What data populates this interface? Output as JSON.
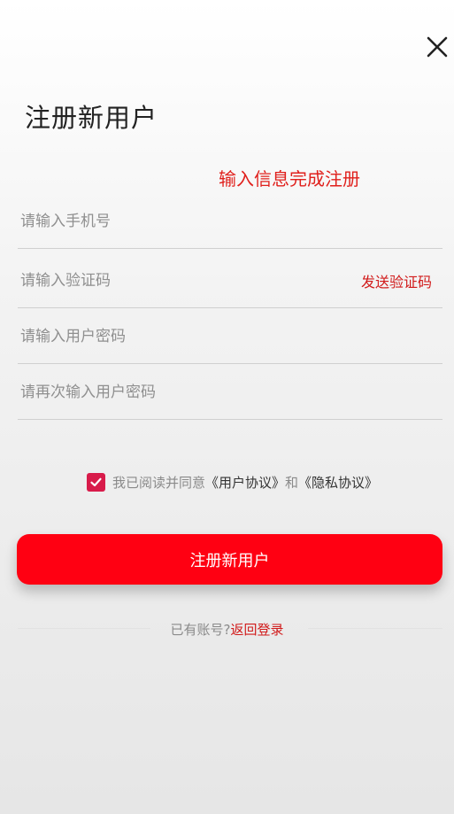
{
  "header": {
    "close_icon": "close-icon",
    "title": "注册新用户",
    "subtitle": "输入信息完成注册"
  },
  "form": {
    "phone_placeholder": "请输入手机号",
    "code_placeholder": "请输入验证码",
    "send_code_label": "发送验证码",
    "password_placeholder": "请输入用户密码",
    "password_confirm_placeholder": "请再次输入用户密码"
  },
  "agreement": {
    "checked": true,
    "prefix": "我已阅读并同意",
    "user_agreement": "《用户协议》",
    "and": "和",
    "privacy_policy": "《隐私协议》"
  },
  "submit_label": "注册新用户",
  "footer": {
    "have_account": "已有账号?",
    "back_to_login": "返回登录"
  },
  "colors": {
    "accent_red": "#ff0012",
    "link_red": "#d11a1a",
    "checkbox": "#d81b4a"
  }
}
